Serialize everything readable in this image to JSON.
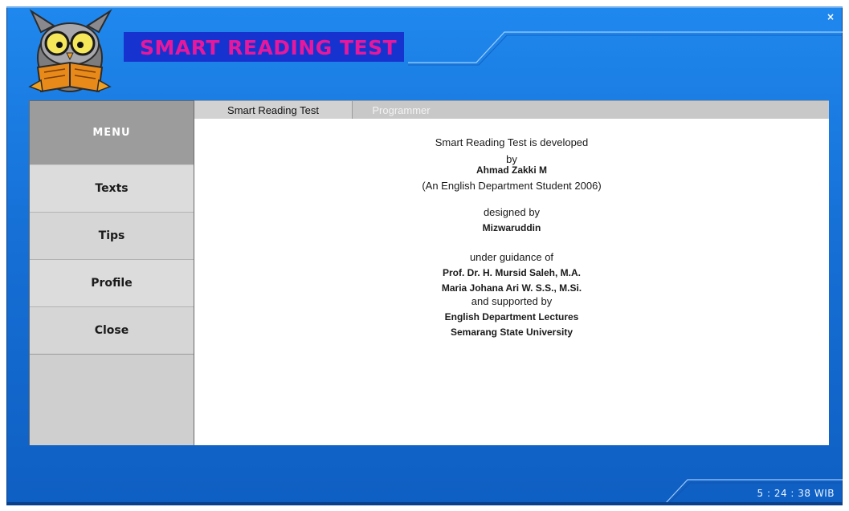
{
  "window": {
    "close_symbol": "×"
  },
  "header": {
    "title": "SMART READING TEST",
    "logo_icon": "owl-reading-book-icon",
    "title_color": "#e7189b",
    "title_bg": "#1733cf"
  },
  "sidebar": {
    "header": "MENU",
    "items": [
      {
        "label": "Texts"
      },
      {
        "label": "Tips"
      },
      {
        "label": "Profile"
      },
      {
        "label": "Close"
      }
    ]
  },
  "tabs": [
    {
      "label": "Smart Reading Test",
      "active": true
    },
    {
      "label": "Programmer",
      "active": false
    }
  ],
  "credits": {
    "line1": "Smart Reading Test is developed",
    "line2": "by",
    "developer": "Ahmad Zakki M",
    "developer_note": "(An English Department Student 2006)",
    "designed_by": "designed by",
    "designer": "Mizwaruddin",
    "under_guidance": "under guidance of",
    "supervisor1": "Prof. Dr. H. Mursid Saleh, M.A.",
    "supervisor2": "Maria Johana Ari W. S.S., M.Si.",
    "supported_by": "and supported by",
    "support1": "English Department Lectures",
    "support2": "Semarang State University"
  },
  "status": {
    "clock": "5 : 24 : 38  WIB"
  },
  "colors": {
    "window_blue": "#1670d6",
    "menu_gray": "#d9d9d9",
    "menu_header": "#9c9c9c"
  }
}
